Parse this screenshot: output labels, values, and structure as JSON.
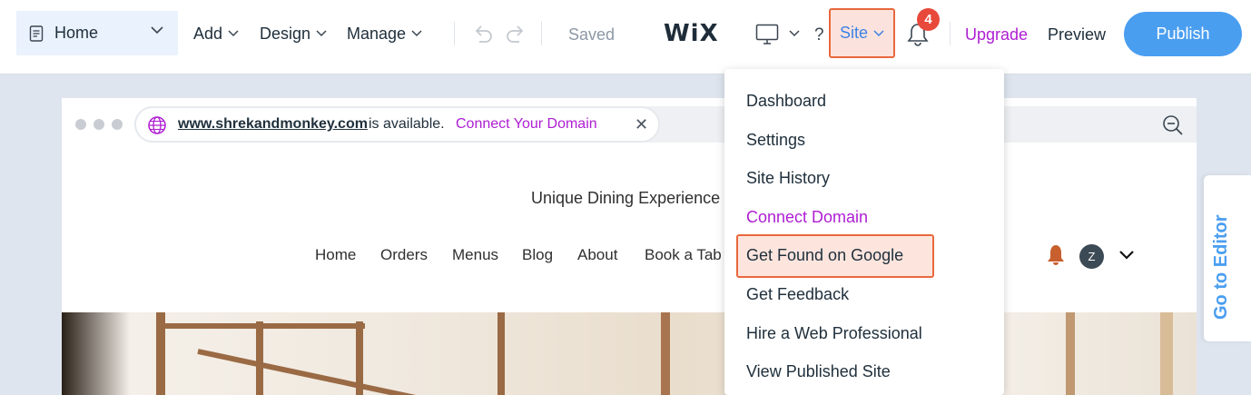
{
  "header": {
    "page_selector": "Home",
    "menu": [
      "Add",
      "Design",
      "Manage"
    ],
    "status": "Saved",
    "logo": "WiX",
    "help": "?",
    "site_menu": "Site",
    "notification_count": "4",
    "upgrade": "Upgrade",
    "preview": "Preview",
    "publish": "Publish"
  },
  "domain_bar": {
    "url": "www.shrekandmonkey.com",
    "available_text": "is available.",
    "connect_label": "Connect Your Domain",
    "close": "✕"
  },
  "site_preview": {
    "tagline": "Unique Dining Experience",
    "nav": [
      "Home",
      "Orders",
      "Menus",
      "Blog",
      "About",
      "Book a Tab"
    ],
    "avatar_initial": "Z"
  },
  "site_dropdown": {
    "items": [
      {
        "label": "Dashboard",
        "style": "normal"
      },
      {
        "label": "Settings",
        "style": "normal"
      },
      {
        "label": "Site History",
        "style": "normal"
      },
      {
        "label": "Connect Domain",
        "style": "purple"
      },
      {
        "label": "Get Found on Google",
        "style": "highlighted"
      },
      {
        "label": "Get Feedback",
        "style": "normal"
      },
      {
        "label": "Hire a Web Professional",
        "style": "normal"
      },
      {
        "label": "View Published Site",
        "style": "normal"
      }
    ]
  },
  "side_tab": {
    "label": "Go to Editor"
  },
  "colors": {
    "accent_blue": "#4a9ef0",
    "purple": "#ae1ed2",
    "highlight_border": "#e8683d",
    "highlight_fill": "#fde5de",
    "badge": "#e8493a"
  }
}
